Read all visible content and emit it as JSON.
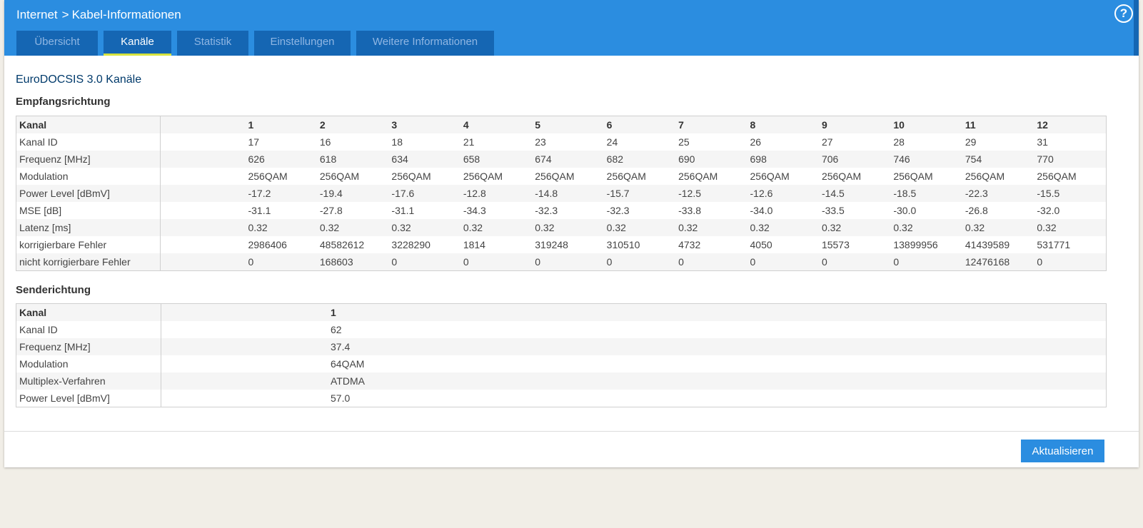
{
  "breadcrumb": {
    "root": "Internet",
    "separator": ">",
    "current": "Kabel-Informationen"
  },
  "help_label": "?",
  "tabs": [
    {
      "label": "Übersicht",
      "active": false
    },
    {
      "label": "Kanäle",
      "active": true
    },
    {
      "label": "Statistik",
      "active": false
    },
    {
      "label": "Einstellungen",
      "active": false
    },
    {
      "label": "Weitere Informationen",
      "active": false
    }
  ],
  "section_title": "EuroDOCSIS 3.0 Kanäle",
  "downstream": {
    "title": "Empfangsrichtung",
    "rows": [
      {
        "label": "Kanal",
        "values": [
          "1",
          "2",
          "3",
          "4",
          "5",
          "6",
          "7",
          "8",
          "9",
          "10",
          "11",
          "12"
        ]
      },
      {
        "label": "Kanal ID",
        "values": [
          "17",
          "16",
          "18",
          "21",
          "23",
          "24",
          "25",
          "26",
          "27",
          "28",
          "29",
          "31"
        ]
      },
      {
        "label": "Frequenz [MHz]",
        "values": [
          "626",
          "618",
          "634",
          "658",
          "674",
          "682",
          "690",
          "698",
          "706",
          "746",
          "754",
          "770"
        ]
      },
      {
        "label": "Modulation",
        "values": [
          "256QAM",
          "256QAM",
          "256QAM",
          "256QAM",
          "256QAM",
          "256QAM",
          "256QAM",
          "256QAM",
          "256QAM",
          "256QAM",
          "256QAM",
          "256QAM"
        ]
      },
      {
        "label": "Power Level [dBmV]",
        "values": [
          "-17.2",
          "-19.4",
          "-17.6",
          "-12.8",
          "-14.8",
          "-15.7",
          "-12.5",
          "-12.6",
          "-14.5",
          "-18.5",
          "-22.3",
          "-15.5"
        ]
      },
      {
        "label": "MSE [dB]",
        "values": [
          "-31.1",
          "-27.8",
          "-31.1",
          "-34.3",
          "-32.3",
          "-32.3",
          "-33.8",
          "-34.0",
          "-33.5",
          "-30.0",
          "-26.8",
          "-32.0"
        ]
      },
      {
        "label": "Latenz [ms]",
        "values": [
          "0.32",
          "0.32",
          "0.32",
          "0.32",
          "0.32",
          "0.32",
          "0.32",
          "0.32",
          "0.32",
          "0.32",
          "0.32",
          "0.32"
        ]
      },
      {
        "label": "korrigierbare Fehler",
        "values": [
          "2986406",
          "48582612",
          "3228290",
          "1814",
          "319248",
          "310510",
          "4732",
          "4050",
          "15573",
          "13899956",
          "41439589",
          "531771"
        ]
      },
      {
        "label": "nicht korrigierbare Fehler",
        "values": [
          "0",
          "168603",
          "0",
          "0",
          "0",
          "0",
          "0",
          "0",
          "0",
          "0",
          "12476168",
          "0"
        ]
      }
    ]
  },
  "upstream": {
    "title": "Senderichtung",
    "rows": [
      {
        "label": "Kanal",
        "values": [
          "1"
        ]
      },
      {
        "label": "Kanal ID",
        "values": [
          "62"
        ]
      },
      {
        "label": "Frequenz [MHz]",
        "values": [
          "37.4"
        ]
      },
      {
        "label": "Modulation",
        "values": [
          "64QAM"
        ]
      },
      {
        "label": "Multiplex-Verfahren",
        "values": [
          "ATDMA"
        ]
      },
      {
        "label": "Power Level [dBmV]",
        "values": [
          "57.0"
        ]
      }
    ]
  },
  "refresh_label": "Aktualisieren",
  "colors": {
    "header": "#2b8de0",
    "tab": "#1566b3",
    "tab_active_underline": "#d6e33f"
  }
}
